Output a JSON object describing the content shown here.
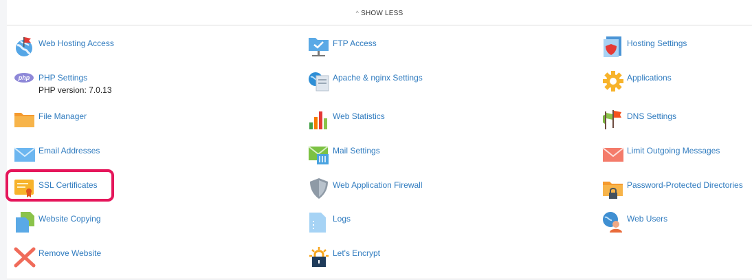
{
  "toggle": {
    "label": "SHOW LESS",
    "icon": "chevron-up-icon"
  },
  "col1": [
    {
      "label": "Web Hosting Access",
      "icon": "globe-flag-icon"
    },
    {
      "label": "PHP Settings",
      "sub": "PHP version: 7.0.13",
      "icon": "php-icon",
      "badge": "php"
    },
    {
      "label": "File Manager",
      "icon": "folder-icon"
    },
    {
      "label": "Email Addresses",
      "icon": "envelope-icon"
    },
    {
      "label": "SSL Certificates",
      "icon": "certificate-icon"
    },
    {
      "label": "Website Copying",
      "icon": "copy-documents-icon"
    },
    {
      "label": "Remove Website",
      "icon": "remove-x-icon"
    }
  ],
  "col2": [
    {
      "label": "FTP Access",
      "icon": "ftp-folder-icon"
    },
    {
      "label": "Apache & nginx Settings",
      "icon": "server-globe-icon"
    },
    {
      "label": "Web Statistics",
      "icon": "bar-chart-icon"
    },
    {
      "label": "Mail Settings",
      "icon": "mail-settings-icon"
    },
    {
      "label": "Web Application Firewall",
      "icon": "shield-icon"
    },
    {
      "label": "Logs",
      "icon": "log-file-icon"
    },
    {
      "label": "Let's Encrypt",
      "icon": "lock-sun-icon"
    }
  ],
  "col3": [
    {
      "label": "Hosting Settings",
      "icon": "hosting-settings-icon"
    },
    {
      "label": "Applications",
      "icon": "gear-icon"
    },
    {
      "label": "DNS Settings",
      "icon": "dns-flags-icon"
    },
    {
      "label": "Limit Outgoing Messages",
      "icon": "limit-mail-icon"
    },
    {
      "label": "Password-Protected Directories",
      "icon": "locked-folder-icon"
    },
    {
      "label": "Web Users",
      "icon": "web-user-icon"
    }
  ],
  "colors": {
    "link": "#2f7bbf",
    "highlight": "#e5165b",
    "background": "#f4f5f7"
  }
}
